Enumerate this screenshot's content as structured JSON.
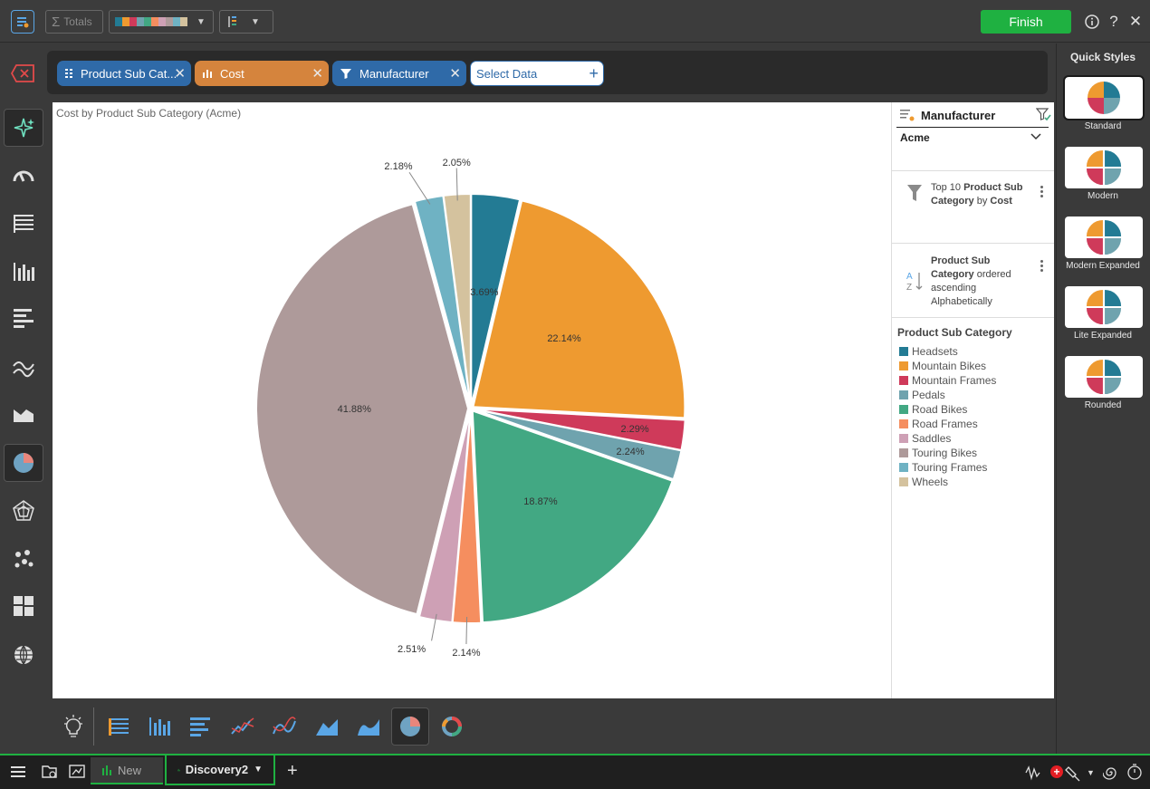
{
  "toolbar": {
    "totals_label": "Totals",
    "finish_label": "Finish",
    "palette": [
      "#237b94",
      "#ee9a30",
      "#cf3a5a",
      "#6fa3ae",
      "#42a883",
      "#f58e5f",
      "#cea0b5",
      "#ae9a9a",
      "#6fb2c3",
      "#d4c29e"
    ]
  },
  "databar": {
    "pills": [
      {
        "label": "Product Sub Cat...",
        "color": "#2f6aa8",
        "icon": "grid-icon"
      },
      {
        "label": "Cost",
        "color": "#d5843d",
        "icon": "bar-icon"
      },
      {
        "label": "Manufacturer",
        "color": "#2f6aa8",
        "icon": "filter-icon"
      }
    ],
    "select_data": "Select Data"
  },
  "chart": {
    "title": "Cost by Product Sub Category (Acme)"
  },
  "chart_data": {
    "type": "pie",
    "title": "Cost by Product Sub Category (Acme)",
    "categories": [
      "Headsets",
      "Mountain Bikes",
      "Mountain Frames",
      "Pedals",
      "Road Bikes",
      "Road Frames",
      "Saddles",
      "Touring Bikes",
      "Touring Frames",
      "Wheels"
    ],
    "values": [
      3.69,
      22.14,
      2.29,
      2.24,
      18.87,
      2.14,
      2.51,
      41.88,
      2.18,
      2.05
    ],
    "labels": [
      "3.69%",
      "22.14%",
      "2.29%",
      "2.24%",
      "18.87%",
      "2.14%",
      "2.51%",
      "41.88%",
      "2.18%",
      "2.05%"
    ],
    "colors": [
      "#237b94",
      "#ee9a30",
      "#cf3a5a",
      "#6fa3ae",
      "#42a883",
      "#f58e5f",
      "#cea0b5",
      "#ae9a9a",
      "#6fb2c3",
      "#d4c29e"
    ],
    "legend_title": "Product Sub Category",
    "legend_position": "right"
  },
  "panel": {
    "filter_title": "Manufacturer",
    "filter_value": "Acme",
    "topn": {
      "line1_a": "Top 10 ",
      "line1_b": "Product Sub",
      "line2_a": "Category",
      "line2_b": " by ",
      "line2_c": "Cost"
    },
    "sort": {
      "line1": "Product Sub",
      "line2_a": "Category",
      "line2_b": " ordered",
      "line3": "ascending",
      "line4": "Alphabetically"
    },
    "legend_title": "Product Sub Category"
  },
  "quick_styles": {
    "title": "Quick Styles",
    "items": [
      "Standard",
      "Modern",
      "Modern Expanded",
      "Lite Expanded",
      "Rounded"
    ]
  },
  "tabs": {
    "new_label": "New",
    "active_label": "Discovery2"
  }
}
